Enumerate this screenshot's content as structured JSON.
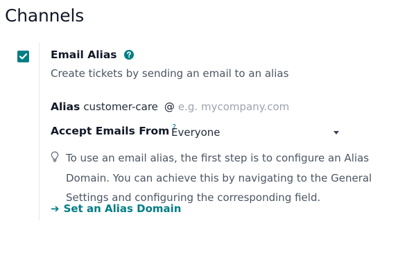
{
  "section": {
    "title": "Channels"
  },
  "setting": {
    "checked": true,
    "label": "Email Alias",
    "help_icon": "question-circle-icon",
    "description": "Create tickets by sending an email to an alias",
    "alias": {
      "label": "Alias",
      "value": "customer-care",
      "at": "@",
      "domain_placeholder": "e.g. mycompany.com"
    },
    "accept": {
      "label": "Accept Emails From",
      "tooltip_mark": "?",
      "selected": "Everyone"
    },
    "hint": {
      "icon": "lightbulb-icon",
      "text": "To use an email alias, the first step is to configure an Alias Domain. You can achieve this by navigating to the General Settings and configuring the corresponding field.",
      "link_arrow": "➔",
      "link_label": "Set an Alias Domain"
    }
  },
  "colors": {
    "accent": "#017e84",
    "help_icon": "#017e84",
    "title": "#111827",
    "muted": "#9ca3af"
  }
}
